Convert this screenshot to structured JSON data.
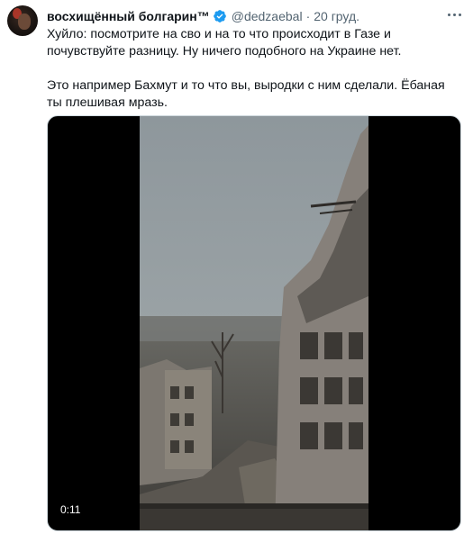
{
  "tweet": {
    "author_name": "восхищённый болгарин™",
    "handle": "@dedzaebal",
    "separator": "·",
    "time": "20 груд.",
    "verified": true,
    "text_line1": "Хуйло: посмотрите на сво и на то что происходит в Газе и почувствуйте разницу. Ну ничего подобного на Украине нет.",
    "text_line2": "Это например Бахмут и то что вы, выродки с ним сделали. Ёбаная ты плешивая мразь.",
    "media": {
      "type": "video",
      "duration": "0:11"
    }
  },
  "icons": {
    "verified": "verified-badge-icon",
    "more": "more-options-icon"
  },
  "colors": {
    "text": "#0f1419",
    "secondary": "#536471",
    "verified": "#1d9bf0",
    "border": "#cfd9de"
  }
}
